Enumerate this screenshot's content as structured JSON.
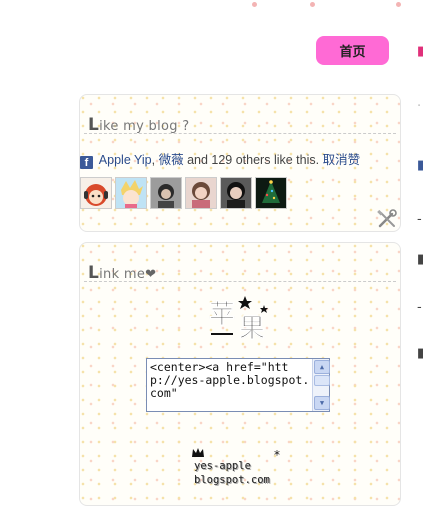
{
  "nav": {
    "home_label": "首页"
  },
  "like_widget": {
    "title_cap": "L",
    "title_rest": "ike my blog ?",
    "fb_icon_glyph": "f",
    "friend_1": "Apple Yip",
    "separator": ", ",
    "friend_2": "微薇",
    "others_text": " and 129 others like this. ",
    "unlike_label": "取消赞",
    "avatar_colors": [
      "#d94a2b",
      "#e8a0a8",
      "#3a3a3a",
      "#c89a8a",
      "#2c2c2c",
      "#1f6b3a"
    ]
  },
  "link_widget": {
    "title_cap": "L",
    "title_rest": "ink me",
    "title_heart": "❤",
    "code_text": "<center><a href=\"http://yes-apple.blogspot.com\"",
    "logo_line1": "yes-apple",
    "logo_line2": "blogspot.com"
  }
}
